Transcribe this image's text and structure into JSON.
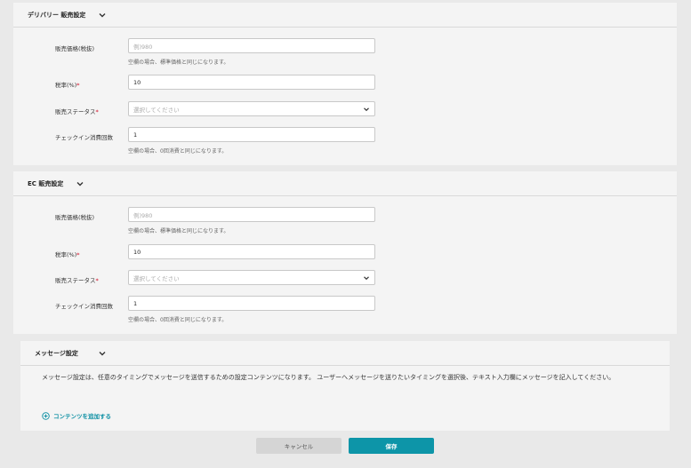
{
  "delivery": {
    "title": "デリバリー 販売設定",
    "price_label": "販売価格(税抜)",
    "price_placeholder": "例)980",
    "price_hint": "空欄の場合、標準価格と同じになります。",
    "tax_label": "税率(%)",
    "tax_value": "10",
    "status_label": "販売ステータス",
    "status_placeholder": "選択してください",
    "checkin_label": "チェックイン消費回数",
    "checkin_value": "1",
    "checkin_hint": "空欄の場合、0回消費と同じになります。"
  },
  "ec": {
    "title": "EC 販売設定",
    "price_label": "販売価格(税抜)",
    "price_placeholder": "例)980",
    "price_hint": "空欄の場合、標準価格と同じになります。",
    "tax_label": "税率(%)",
    "tax_value": "10",
    "status_label": "販売ステータス",
    "status_placeholder": "選択してください",
    "checkin_label": "チェックイン消費回数",
    "checkin_value": "1",
    "checkin_hint": "空欄の場合、0回消費と同じになります。"
  },
  "message": {
    "title": "メッセージ設定",
    "description": "メッセージ設定は、任意のタイミングでメッセージを送信するための設定コンテンツになります。 ユーザーへメッセージを送りたいタイミングを選択後、テキスト入力欄にメッセージを記入してください。",
    "add_content_label": "コンテンツを追加する"
  },
  "footer": {
    "cancel_label": "キャンセル",
    "save_label": "保存"
  },
  "colors": {
    "accent": "#0d95a8",
    "required": "#d0021b"
  }
}
